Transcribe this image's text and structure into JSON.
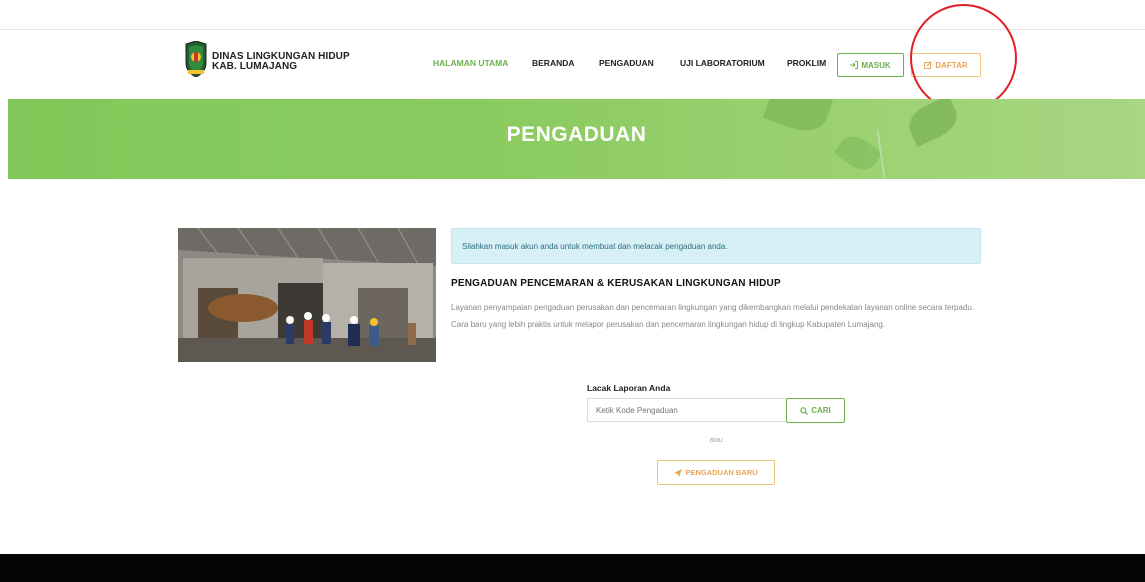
{
  "header": {
    "brand_line1": "DINAS LINGKUNGAN HIDUP",
    "brand_line2": "KAB. LUMAJANG",
    "nav": [
      {
        "label": "HALAMAN UTAMA"
      },
      {
        "label": "BERANDA"
      },
      {
        "label": "PENGADUAN"
      },
      {
        "label": "UJI LABORATORIUM"
      },
      {
        "label": "PROKLIM"
      }
    ],
    "masuk_label": "MASUK",
    "daftar_label": "DAFTAR"
  },
  "banner": {
    "title": "PENGADUAN"
  },
  "main": {
    "alert_text": "Silahkan masuk akun anda untuk membuat dan melacak pengaduan anda.",
    "section_title": "PENGADUAN PENCEMARAN & KERUSAKAN LINGKUNGAN HIDUP",
    "description": "Layanan penyampaian pengaduan perusakan dan pencemaran lingkungan yang dikembangkan melalui pendekatan layanan online secara terpadu. Cara baru yang lebih praktis untuk melapor perusakan dan pencemaran lingkungan hidup di lingkup Kabupaten Lumajang.",
    "track_label": "Lacak Laporan Anda",
    "track_placeholder": "Ketik Kode Pengaduan",
    "cari_label": "CARI",
    "atau": "atau",
    "new_complaint_label": "PENGADUAN BARU"
  },
  "colors": {
    "accent_green": "#6ab04c",
    "accent_orange": "#e6a55a",
    "banner_green": "#8bcb60",
    "annotation_red": "#e31e24"
  },
  "icons": [
    "logo-emblem-icon",
    "sign-in-icon",
    "edit-icon",
    "search-icon",
    "send-icon"
  ]
}
